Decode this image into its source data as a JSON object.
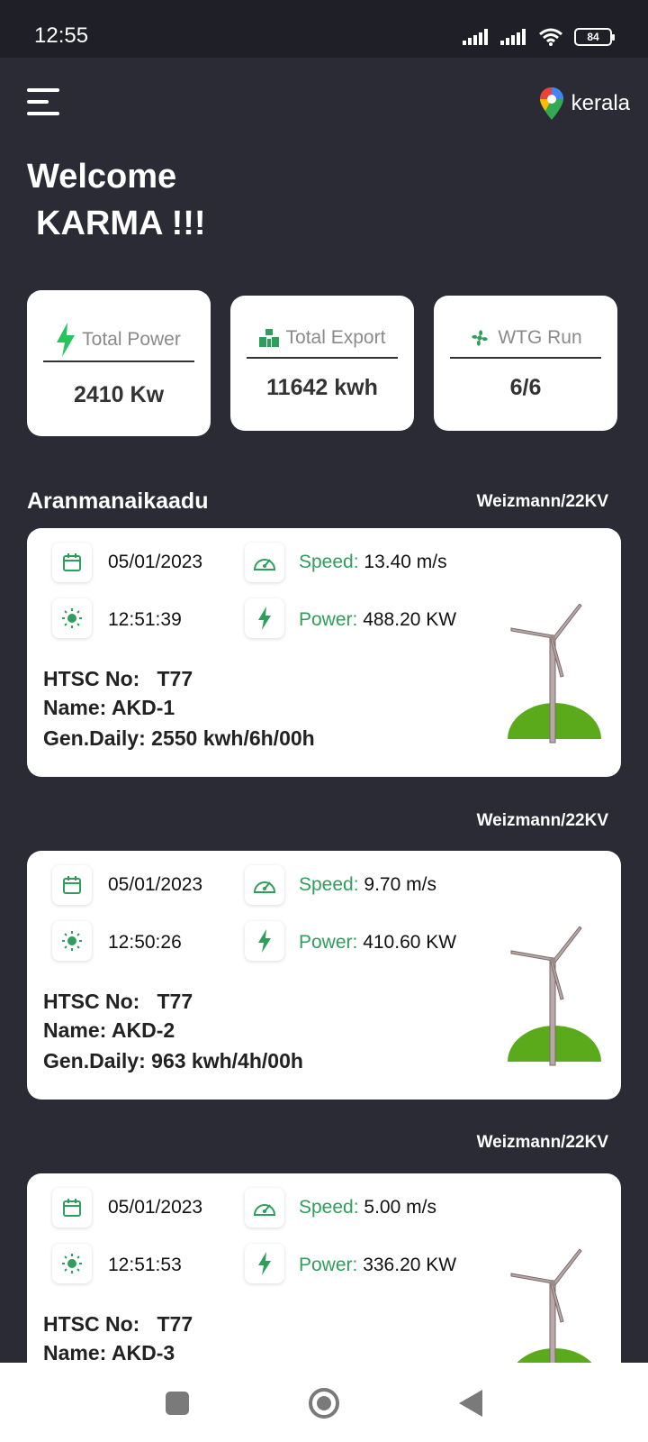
{
  "status_bar": {
    "time": "12:55",
    "battery": "84"
  },
  "header": {
    "location": "kerala"
  },
  "welcome": {
    "line1": "Welcome",
    "line2": "KARMA !!!"
  },
  "stats": [
    {
      "label": "Total Power",
      "value": "2410 Kw",
      "icon": "bolt-icon"
    },
    {
      "label": "Total Export",
      "value": "11642  kwh",
      "icon": "export-icon"
    },
    {
      "label": "WTG Run",
      "value": "6/6",
      "icon": "fan-icon"
    }
  ],
  "section": {
    "title": "Aranmanaikaadu"
  },
  "labels": {
    "speed": "Speed:",
    "power": "Power:",
    "htsc": "HTSC No:",
    "name": "Name:",
    "gen": "Gen.Daily:"
  },
  "turbines": [
    {
      "source": "Weizmann/22KV",
      "date": "05/01/2023",
      "time": "12:51:39",
      "speed": "13.40 m/s",
      "power": "488.20 KW",
      "htsc": "T77",
      "name": "AKD-1",
      "gen": "2550 kwh/6h/00h"
    },
    {
      "source": "Weizmann/22KV",
      "date": "05/01/2023",
      "time": "12:50:26",
      "speed": "9.70 m/s",
      "power": "410.60 KW",
      "htsc": "T77",
      "name": "AKD-2",
      "gen": "963 kwh/4h/00h"
    },
    {
      "source": "Weizmann/22KV",
      "date": "05/01/2023",
      "time": "12:51:53",
      "speed": "5.00 m/s",
      "power": "336.20 KW",
      "htsc": "T77",
      "name": "AKD-3",
      "gen": ""
    }
  ],
  "colors": {
    "accent": "#2e9e5b",
    "background": "#2b2b36",
    "bolt": "#22c55e",
    "hill": "#5aaa1c"
  }
}
